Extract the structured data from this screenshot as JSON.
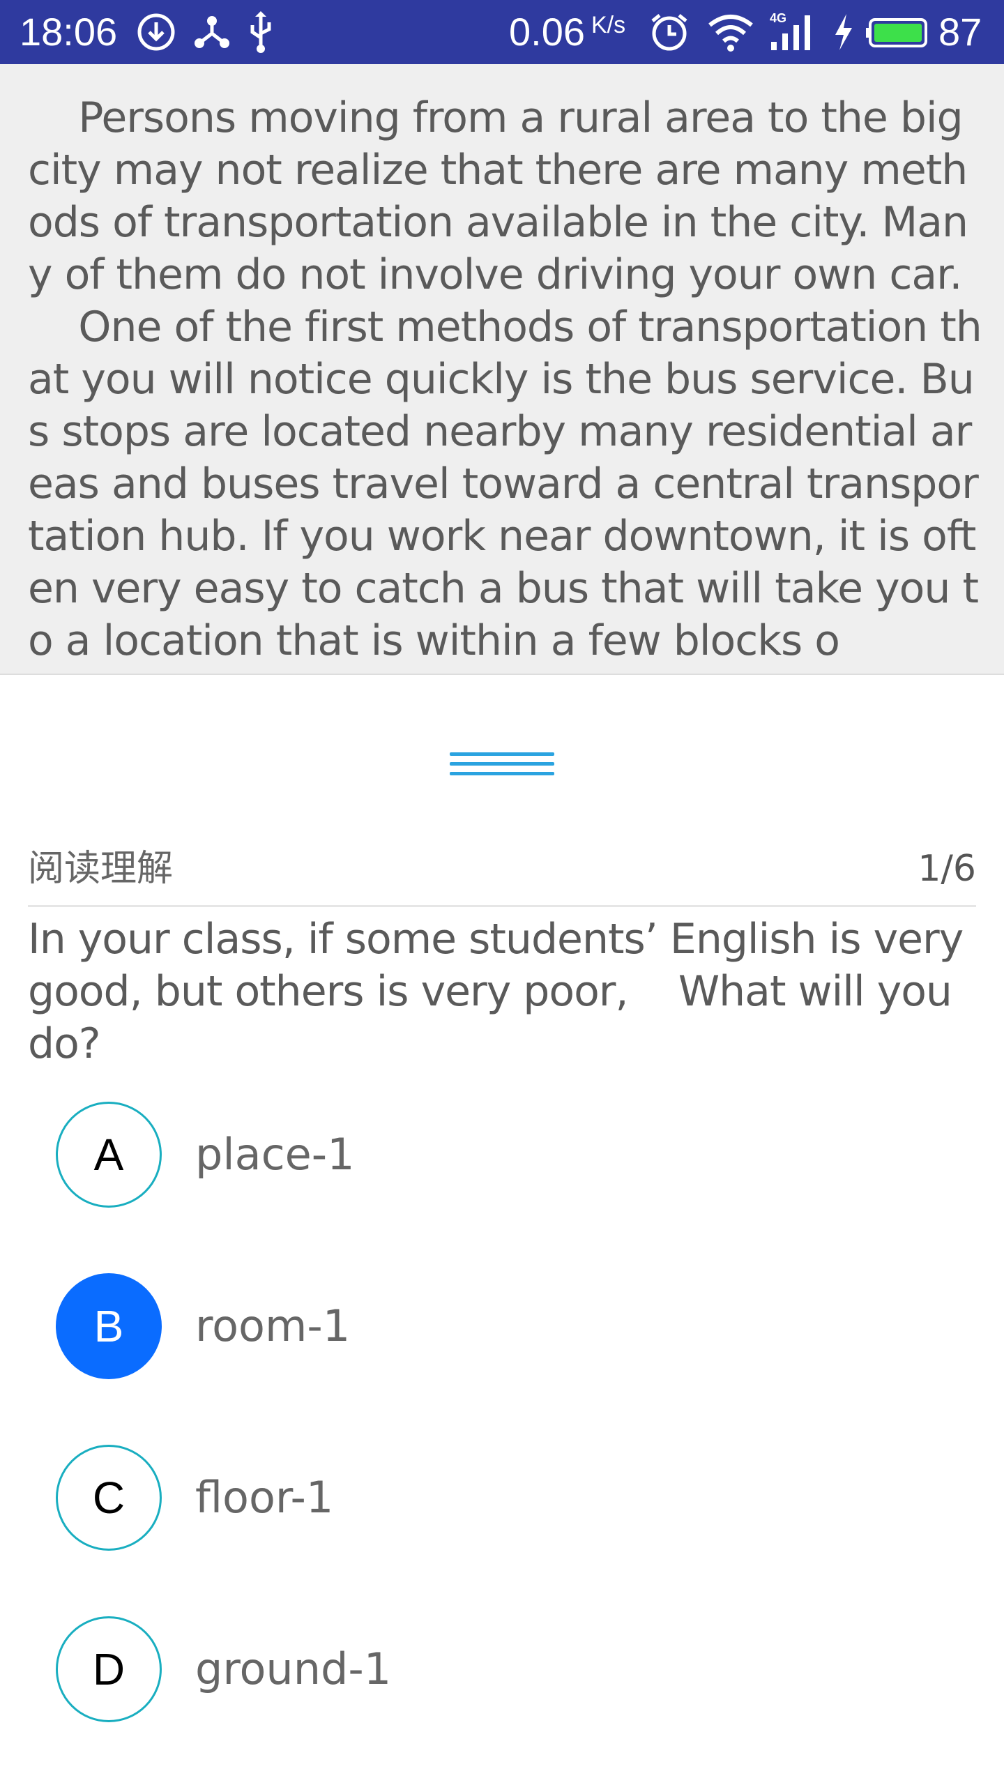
{
  "status_bar": {
    "time": "18:06",
    "network_speed": "0.06",
    "network_speed_unit": "K/s",
    "network_type": "4G",
    "battery_percent": "87",
    "icons": [
      "download-icon",
      "share-icon",
      "usb-icon",
      "alarm-icon",
      "wifi-icon",
      "signal-icon",
      "charging-icon",
      "battery-icon"
    ],
    "background_color": "#2f3a9f"
  },
  "passage": {
    "paragraphs": [
      "    Persons moving from a rural area to the big city may not realize that there are many methods of transportation available in the city. Many of them do not involve driving your own car.",
      "    One of the first methods of transportation that you will notice quickly is the bus service. Bus stops are located nearby many residential areas and buses travel toward a central transportation hub. If you work near downtown, it is often very easy to catch a bus that will take you to a location that is within a few blocks o"
    ]
  },
  "question": {
    "type_label": "阅读理解",
    "counter": "1/6",
    "text": "In your class, if some students’ English is very good, but others is very poor,    What will you do?"
  },
  "options": [
    {
      "letter": "A",
      "label": "place-1",
      "selected": false
    },
    {
      "letter": "B",
      "label": "room-1",
      "selected": true
    },
    {
      "letter": "C",
      "label": "floor-1",
      "selected": false
    },
    {
      "letter": "D",
      "label": "ground-1",
      "selected": false
    }
  ],
  "colors": {
    "option_border": "#19aec0",
    "option_selected": "#0a6cff",
    "handle": "#2aa3e0"
  }
}
